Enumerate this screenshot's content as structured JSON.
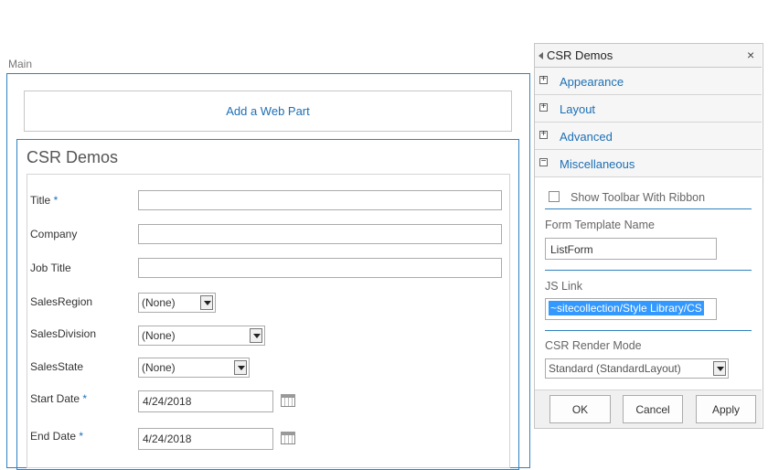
{
  "zone": {
    "label": "Main",
    "add_webpart": "Add a Web Part"
  },
  "webpart": {
    "title": "CSR Demos",
    "fields": [
      {
        "label": "Title",
        "required": "*"
      },
      {
        "label": "Company"
      },
      {
        "label": "Job Title"
      },
      {
        "label": "SalesRegion",
        "value": "(None)"
      },
      {
        "label": "SalesDivision",
        "value": "(None)"
      },
      {
        "label": "SalesState",
        "value": "(None)"
      },
      {
        "label": "Start Date",
        "required": "*",
        "value": "4/24/2018"
      },
      {
        "label": "End Date",
        "required": "*",
        "value": "4/24/2018"
      }
    ]
  },
  "toolpane": {
    "title": "CSR Demos",
    "close": "×",
    "sections": [
      {
        "label": "Appearance",
        "toggle": "+"
      },
      {
        "label": "Layout",
        "toggle": "+"
      },
      {
        "label": "Advanced",
        "toggle": "+"
      },
      {
        "label": "Miscellaneous",
        "toggle": "−"
      }
    ],
    "misc": {
      "show_toolbar_label": "Show Toolbar With Ribbon",
      "form_template_label": "Form Template Name",
      "form_template_value": "ListForm",
      "jslink_label": "JS Link",
      "jslink_value": "~sitecollection/Style Library/CS",
      "render_mode_label": "CSR Render Mode",
      "render_mode_value": "Standard (StandardLayout)"
    },
    "buttons": {
      "ok": "OK",
      "cancel": "Cancel",
      "apply": "Apply"
    }
  },
  "colors": {
    "accent": "#1c6fb5",
    "zone_border": "#2f82c0",
    "selection": "#3399ff"
  }
}
